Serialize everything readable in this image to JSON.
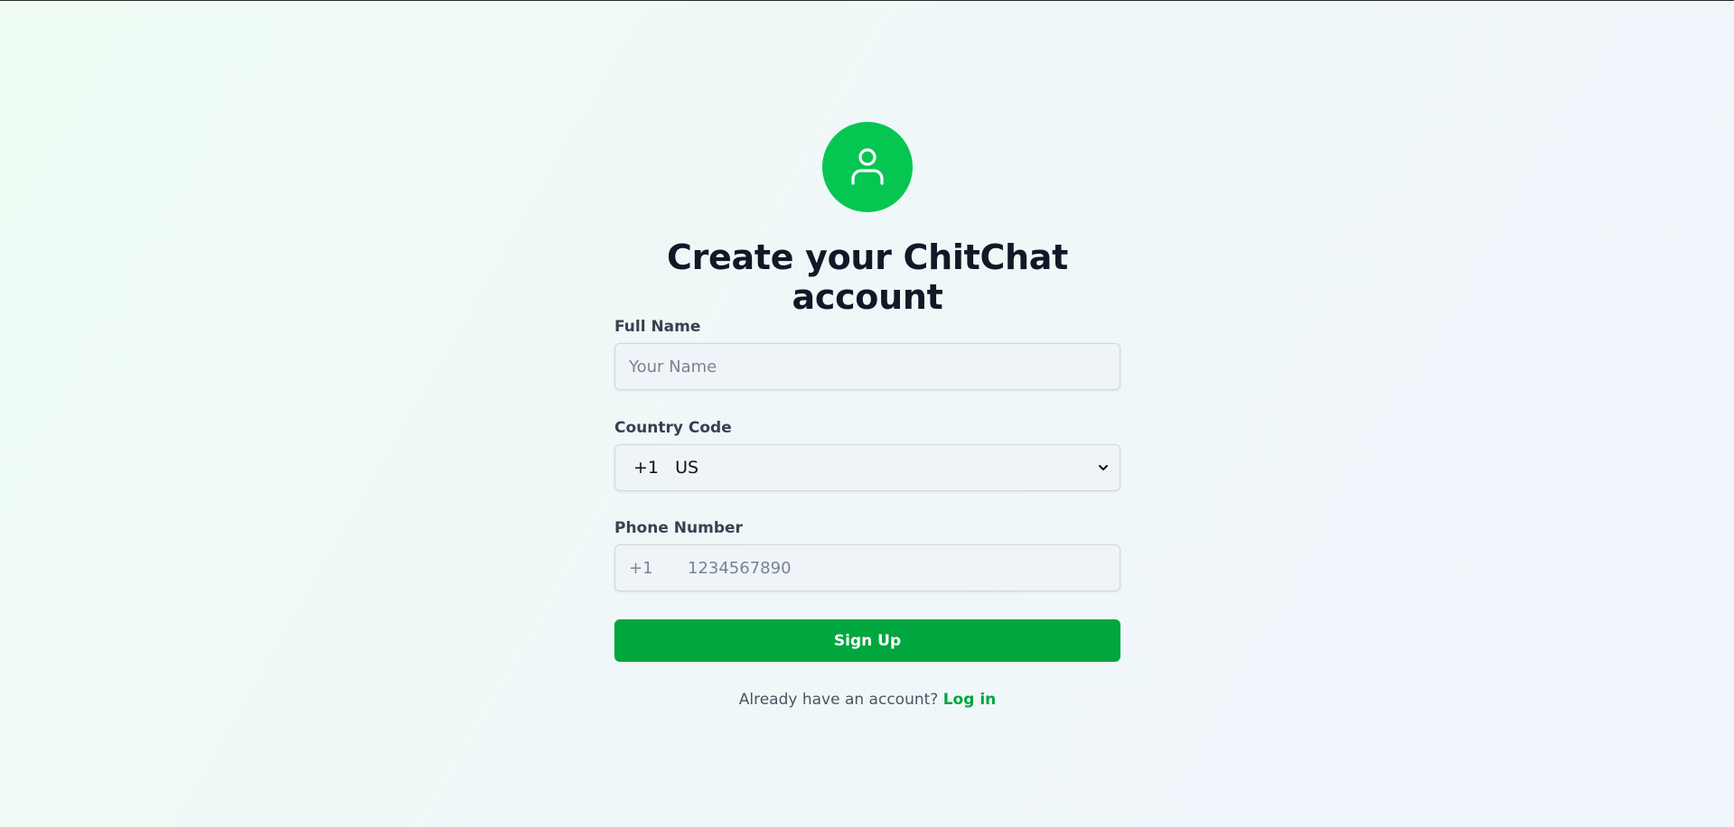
{
  "header": {
    "avatar_icon": "user-icon",
    "title": "Create your ChitChat account"
  },
  "form": {
    "name": {
      "label": "Full Name",
      "placeholder": "Your Name",
      "value": ""
    },
    "country": {
      "label": "Country Code",
      "selected_code": "+1",
      "selected_country": "US",
      "selected_display": "+1   US"
    },
    "phone": {
      "label": "Phone Number",
      "prefix": "+1",
      "placeholder": "1234567890",
      "value": ""
    },
    "submit_label": "Sign Up"
  },
  "footer": {
    "prompt": "Already have an account?",
    "link_label": "Log in"
  },
  "colors": {
    "accent": "#06c652",
    "button": "#00a63e",
    "title": "#111827",
    "label": "#374151"
  }
}
